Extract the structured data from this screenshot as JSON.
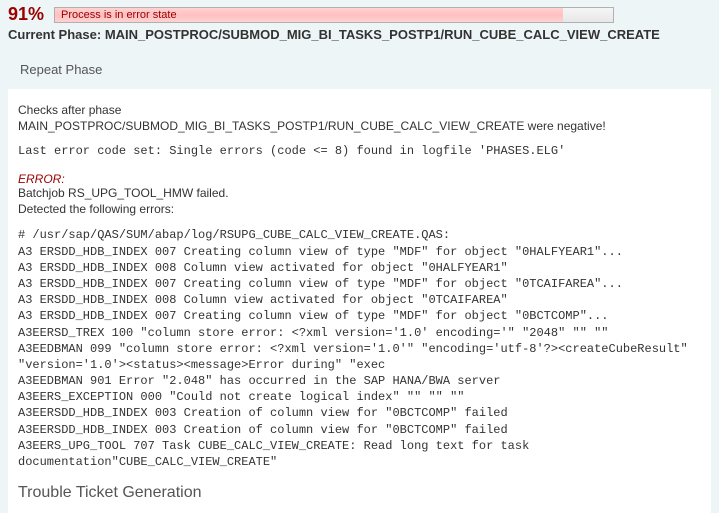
{
  "header": {
    "percent": "91%",
    "progress_text": "Process is in error state",
    "phase_prefix": "Current Phase: ",
    "phase_path": "MAIN_POSTPROC/SUBMOD_MIG_BI_TASKS_POSTP1/RUN_CUBE_CALC_VIEW_CREATE"
  },
  "repeat_phase": "Repeat Phase",
  "checks": {
    "line1": "Checks after phase",
    "line2": "MAIN_POSTPROC/SUBMOD_MIG_BI_TASKS_POSTP1/RUN_CUBE_CALC_VIEW_CREATE were negative!"
  },
  "last_error": "Last error code set: Single errors (code <= 8) found in logfile 'PHASES.ELG'",
  "error": {
    "label": "ERROR:",
    "line1": "Batchjob RS_UPG_TOOL_HMW failed.",
    "line2": "Detected the following errors:"
  },
  "log": [
    "# /usr/sap/QAS/SUM/abap/log/RSUPG_CUBE_CALC_VIEW_CREATE.QAS:",
    "A3 ERSDD_HDB_INDEX 007 Creating column view of type \"MDF\" for object \"0HALFYEAR1\"...",
    "A3 ERSDD_HDB_INDEX 008 Column view activated for object \"0HALFYEAR1\"",
    "A3 ERSDD_HDB_INDEX 007 Creating column view of type \"MDF\" for object \"0TCAIFAREA\"...",
    "A3 ERSDD_HDB_INDEX 008 Column view activated for object \"0TCAIFAREA\"",
    "A3 ERSDD_HDB_INDEX 007 Creating column view of type \"MDF\" for object \"0BCTCOMP\"...",
    "A3EERSD_TREX 100 \"column store error: <?xml version='1.0' encoding='\" \"2048\" \"\" \"\"",
    "A3EEDBMAN 099 \"column store error: <?xml version='1.0'\" \"encoding='utf-8'?><createCubeResult\"",
    "\"version='1.0'><status><message>Error during\" \"exec",
    "A3EEDBMAN 901 Error \"2.048\" has occurred in the SAP HANA/BWA server",
    "A3EERS_EXCEPTION 000 \"Could not create logical index\" \"\" \"\" \"\"",
    "A3EERSDD_HDB_INDEX 003 Creation of column view for \"0BCTCOMP\" failed",
    "A3EERSDD_HDB_INDEX 003 Creation of column view for \"0BCTCOMP\" failed",
    "A3EERS_UPG_TOOL 707 Task CUBE_CALC_VIEW_CREATE: Read long text for task",
    "documentation\"CUBE_CALC_VIEW_CREATE\""
  ],
  "trouble_title": "Trouble Ticket Generation"
}
